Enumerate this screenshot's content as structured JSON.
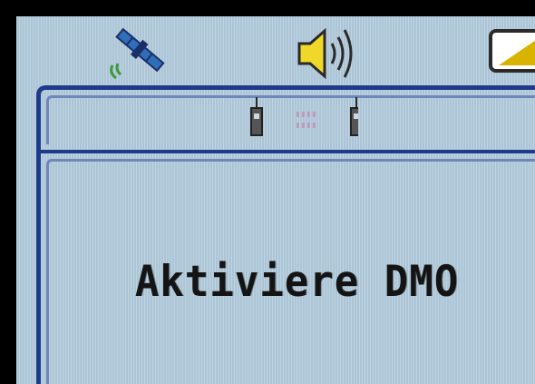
{
  "status_bar": {
    "icons": [
      "satellite-signal-icon",
      "speaker-volume-icon",
      "battery-icon"
    ]
  },
  "dialog": {
    "header_icon": "dmo-radio-link-icon",
    "message": "Aktiviere DMO"
  },
  "colors": {
    "screen_background": "#b6cfe0",
    "frame": "#1f3a8a",
    "speaker": "#f0d82a",
    "battery_fill": "#d8b400",
    "text": "#141414"
  }
}
